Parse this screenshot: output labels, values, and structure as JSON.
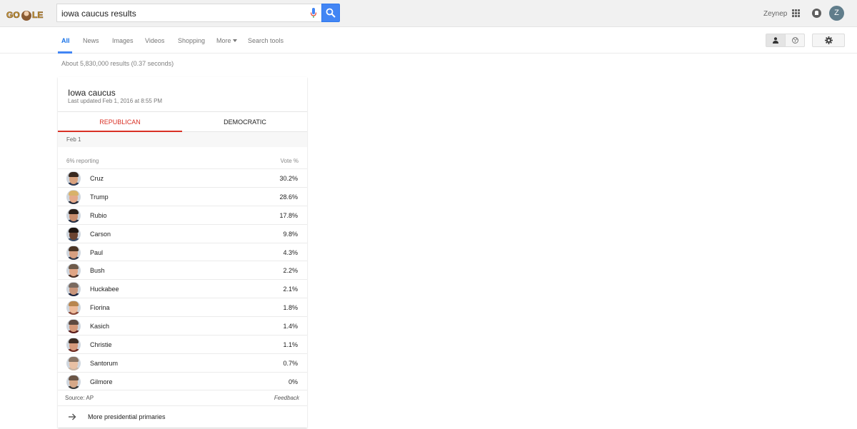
{
  "header": {
    "logo_text": "GOOGLE",
    "search_query": "iowa caucus results",
    "user_name": "Zeynep",
    "avatar_initial": "Z"
  },
  "nav": {
    "tabs": [
      "All",
      "News",
      "Images",
      "Videos",
      "Shopping",
      "More",
      "Search tools"
    ]
  },
  "result_stats": "About 5,830,000 results (0.37 seconds)",
  "card": {
    "title": "Iowa caucus",
    "updated": "Last updated Feb 1, 2016 at 8:55 PM",
    "tabs": [
      "REPUBLICAN",
      "DEMOCRATIC"
    ],
    "date": "Feb 1",
    "reporting": "6% reporting",
    "vote_header": "Vote %",
    "candidates": [
      {
        "name": "Cruz",
        "pct": "30.2%",
        "skin": "#d9a27e",
        "hair": "#3a2a20",
        "body": "#2b3a55"
      },
      {
        "name": "Trump",
        "pct": "28.6%",
        "skin": "#e4a98a",
        "hair": "#d8b26a",
        "body": "#2a2f3d"
      },
      {
        "name": "Rubio",
        "pct": "17.8%",
        "skin": "#c98d6d",
        "hair": "#2a1e18",
        "body": "#263045"
      },
      {
        "name": "Carson",
        "pct": "9.8%",
        "skin": "#6b4330",
        "hair": "#1e140f",
        "body": "#3c4f6b"
      },
      {
        "name": "Paul",
        "pct": "4.3%",
        "skin": "#d79f80",
        "hair": "#4a3424",
        "body": "#30384a"
      },
      {
        "name": "Bush",
        "pct": "2.2%",
        "skin": "#e0a585",
        "hair": "#6d5a4a",
        "body": "#4a2f25"
      },
      {
        "name": "Huckabee",
        "pct": "2.1%",
        "skin": "#c9957a",
        "hair": "#7a6a60",
        "body": "#1c2540"
      },
      {
        "name": "Fiorina",
        "pct": "1.8%",
        "skin": "#edbb9b",
        "hair": "#b8864f",
        "body": "#8a4a3a"
      },
      {
        "name": "Kasich",
        "pct": "1.4%",
        "skin": "#d69a7a",
        "hair": "#5e4a40",
        "body": "#5a1c1c"
      },
      {
        "name": "Christie",
        "pct": "1.1%",
        "skin": "#d59a7c",
        "hair": "#3b2b22",
        "body": "#6d2a22"
      },
      {
        "name": "Santorum",
        "pct": "0.7%",
        "skin": "#e8c0a4",
        "hair": "#8a7565",
        "body": "#c9b5a5"
      },
      {
        "name": "Gilmore",
        "pct": "0%",
        "skin": "#d6a888",
        "hair": "#6a5546",
        "body": "#3a3a3a"
      }
    ],
    "source": "Source: AP",
    "feedback": "Feedback",
    "more_link": "More presidential primaries"
  },
  "colors": {
    "accent_blue": "#4285f4",
    "republican_red": "#d93025"
  }
}
